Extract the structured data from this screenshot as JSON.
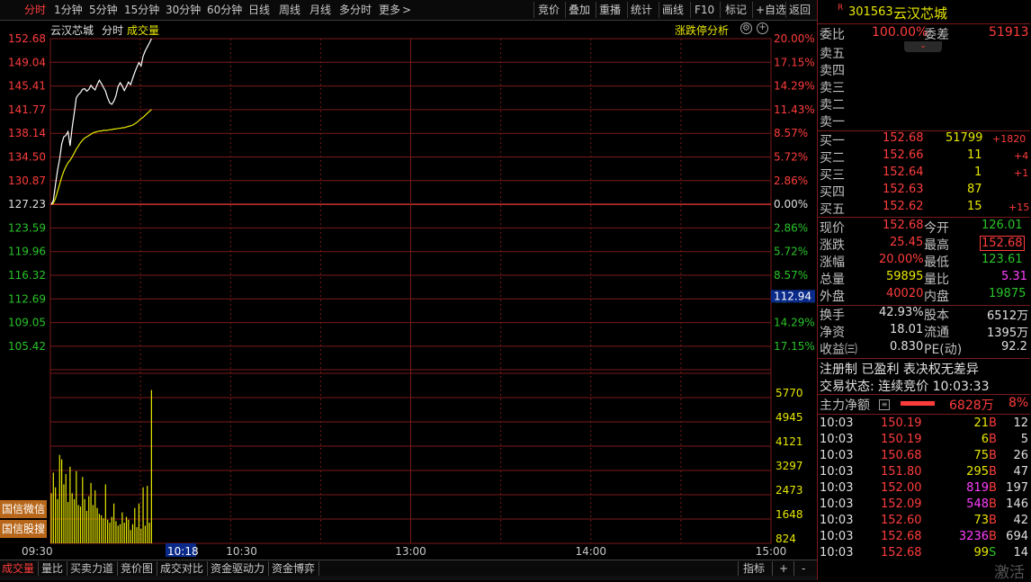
{
  "toolbar": {
    "left": [
      "分时",
      "1分钟",
      "5分钟",
      "15分钟",
      "30分钟",
      "60分钟",
      "日线",
      "周线",
      "月线",
      "多分时",
      "更多"
    ],
    "more_arrow": ">",
    "right": [
      "竞价",
      "叠加",
      "重播",
      "统计",
      "画线",
      "F10",
      "标记",
      "+自选",
      "返回"
    ]
  },
  "chart_header": {
    "stock_name": "云汉芯城",
    "mode": "分时",
    "volume_label": "成交量",
    "limit_analysis": "涨跌停分析"
  },
  "price_axis": {
    "left": [
      "152.68",
      "149.04",
      "145.41",
      "141.77",
      "138.14",
      "134.50",
      "130.87",
      "127.23",
      "123.59",
      "119.96",
      "116.32",
      "112.69",
      "109.05",
      "105.42"
    ],
    "right": [
      "20.00%",
      "17.15%",
      "14.29%",
      "11.43%",
      "8.57%",
      "5.72%",
      "2.86%",
      "0.00%",
      "2.86%",
      "5.72%",
      "8.57%",
      "11.43%",
      "14.29%",
      "17.15%"
    ],
    "cursor_value": "112.94"
  },
  "volume_axis": [
    "5770",
    "4945",
    "4121",
    "3297",
    "2473",
    "1648",
    "824"
  ],
  "time_axis": {
    "labels": [
      "09:30",
      "10:30",
      "13:00",
      "14:00",
      "15:00"
    ],
    "cursor": "10:18"
  },
  "side_buttons": [
    "国信微信",
    "国信股搜"
  ],
  "bottom_tabs": [
    "成交量",
    "量比",
    "买卖力道",
    "竞价图",
    "成交对比",
    "资金驱动力",
    "资金博弈"
  ],
  "bottom_right": {
    "indicator": "指标",
    "plus": "+",
    "minus": "-"
  },
  "colors": {
    "up": "#ff3c3c",
    "down": "#29c429",
    "price_line": "#ffffff",
    "avg_line": "#e8e800",
    "grid": "#7a1a1a"
  },
  "quote": {
    "badge": "R",
    "code": "301563",
    "name": "云汉芯城",
    "wei_bi_label": "委比",
    "wei_bi": "100.00%",
    "wei_cha_label": "委差",
    "wei_cha": "51913",
    "sell": [
      {
        "label": "卖五"
      },
      {
        "label": "卖四"
      },
      {
        "label": "卖三"
      },
      {
        "label": "卖二"
      },
      {
        "label": "卖一"
      }
    ],
    "buy": [
      {
        "label": "买一",
        "price": "152.68",
        "vol": "51799",
        "chg": "+1820"
      },
      {
        "label": "买二",
        "price": "152.66",
        "vol": "11",
        "chg": "+4"
      },
      {
        "label": "买三",
        "price": "152.64",
        "vol": "1",
        "chg": "+1"
      },
      {
        "label": "买四",
        "price": "152.63",
        "vol": "87",
        "chg": ""
      },
      {
        "label": "买五",
        "price": "152.62",
        "vol": "15",
        "chg": "+15"
      }
    ],
    "stats": [
      {
        "l1": "现价",
        "v1": "152.68",
        "l2": "今开",
        "v2": "126.01"
      },
      {
        "l1": "涨跌",
        "v1": "25.45",
        "l2": "最高",
        "v2": "152.68"
      },
      {
        "l1": "涨幅",
        "v1": "20.00%",
        "l2": "最低",
        "v2": "123.61"
      },
      {
        "l1": "总量",
        "v1": "59895",
        "l2": "量比",
        "v2": "5.31"
      },
      {
        "l1": "外盘",
        "v1": "40020",
        "l2": "内盘",
        "v2": "19875"
      }
    ],
    "stats2": [
      {
        "l1": "换手",
        "v1": "42.93%",
        "l2": "股本",
        "v2": "6512万"
      },
      {
        "l1": "净资",
        "v1": "18.01",
        "l2": "流通",
        "v2": "1395万"
      },
      {
        "l1": "收益㈢",
        "v1": "0.830",
        "l2": "PE(动)",
        "v2": "92.2"
      }
    ],
    "tags": "注册制 已盈利 表决权无差异",
    "trade_status": "交易状态: 连续竞价 10:03:33",
    "main_force_label": "主力净额",
    "main_force_value": "6828万",
    "main_force_pct": "8%"
  },
  "trades": [
    {
      "time": "10:03",
      "price": "150.19",
      "vol": "21",
      "side": "B",
      "n": "12"
    },
    {
      "time": "10:03",
      "price": "150.19",
      "vol": "6",
      "side": "B",
      "n": "5"
    },
    {
      "time": "10:03",
      "price": "150.68",
      "vol": "75",
      "side": "B",
      "n": "26"
    },
    {
      "time": "10:03",
      "price": "151.80",
      "vol": "295",
      "side": "B",
      "n": "47"
    },
    {
      "time": "10:03",
      "price": "152.00",
      "vol": "819",
      "side": "B",
      "n": "197"
    },
    {
      "time": "10:03",
      "price": "152.09",
      "vol": "548",
      "side": "B",
      "n": "146"
    },
    {
      "time": "10:03",
      "price": "152.60",
      "vol": "73",
      "side": "B",
      "n": "42"
    },
    {
      "time": "10:03",
      "price": "152.68",
      "vol": "3236",
      "side": "B",
      "n": "694"
    },
    {
      "time": "10:03",
      "price": "152.68",
      "vol": "99",
      "side": "S",
      "n": "14"
    }
  ],
  "watermark": "激活",
  "chart_data": {
    "type": "line",
    "x_minutes": [
      0,
      1,
      2,
      3,
      4,
      5,
      6,
      7,
      8,
      9,
      10,
      11,
      12,
      13,
      14,
      15,
      16,
      17,
      18,
      19,
      20,
      21,
      22,
      23,
      24,
      25,
      26,
      27,
      28,
      29,
      30,
      31,
      32,
      33,
      34,
      35,
      36,
      37,
      38,
      39,
      40,
      41,
      42,
      43,
      44,
      45,
      46,
      47,
      48
    ],
    "series": [
      {
        "values": [
          127.23,
          127.8,
          130.2,
          132.5,
          134.2,
          136.5,
          137.6,
          137.8,
          138.4,
          136.2,
          139.0,
          141.2,
          143.6,
          144.1,
          144.4,
          144.9,
          145.0,
          144.6,
          144.9,
          145.5,
          145.1,
          144.8,
          145.6,
          146.3,
          145.8,
          145.2,
          144.6,
          143.6,
          142.8,
          142.6,
          143.1,
          143.9,
          145.3,
          145.9,
          145.4,
          144.7,
          145.3,
          146.0,
          145.6,
          146.6,
          147.5,
          148.3,
          149.0,
          148.5,
          150.0,
          150.8,
          151.4,
          152.0,
          152.68
        ]
      },
      {
        "values": [
          127.23,
          127.4,
          128.1,
          129.2,
          130.3,
          131.4,
          132.3,
          133.0,
          133.6,
          134.0,
          134.5,
          135.1,
          135.7,
          136.2,
          136.7,
          137.1,
          137.4,
          137.6,
          137.8,
          138.0,
          138.2,
          138.3,
          138.4,
          138.5,
          138.5,
          138.6,
          138.6,
          138.6,
          138.7,
          138.7,
          138.8,
          138.8,
          138.9,
          138.9,
          139.0,
          139.0,
          139.1,
          139.2,
          139.3,
          139.4,
          139.6,
          139.8,
          140.1,
          140.4,
          140.6,
          140.9,
          141.2,
          141.5,
          141.8
        ]
      }
    ],
    "volume": [
      1700,
      2400,
      1900,
      1500,
      3000,
      2850,
      2000,
      2350,
      1400,
      2600,
      1700,
      1500,
      2450,
      1300,
      1250,
      2250,
      1500,
      1100,
      1600,
      2050,
      1300,
      1800,
      1200,
      1000,
      950,
      850,
      2000,
      800,
      700,
      900,
      1350,
      750,
      600,
      650,
      1050,
      700,
      900,
      800,
      450,
      650,
      1200,
      550,
      1350,
      500,
      1900,
      600,
      1950,
      700,
      5200
    ],
    "ylim": [
      101.78,
      152.68
    ],
    "base_price": 127.23,
    "vol_max": 5770
  }
}
